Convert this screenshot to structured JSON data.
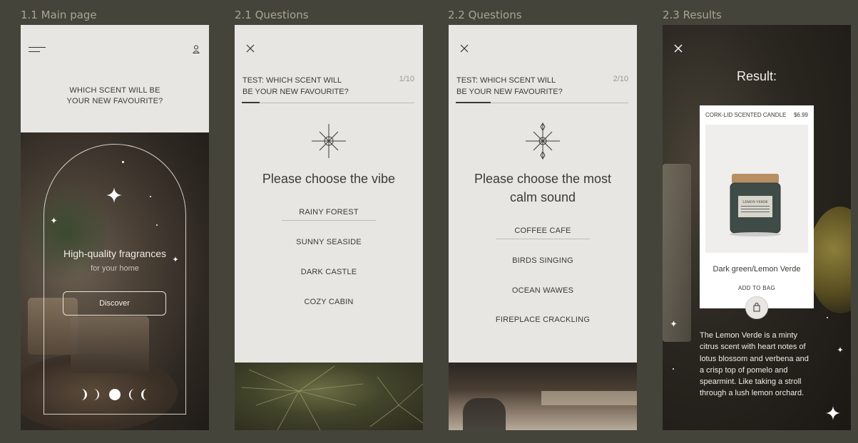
{
  "labels": {
    "main": "1.1 Main page",
    "q1": "2.1 Questions",
    "q2": "2.2 Questions",
    "results": "2.3 Results"
  },
  "main_page": {
    "menu_icon": "hamburger-icon",
    "user_icon": "user-icon",
    "title_line1": "WHICH SCENT WILL BE",
    "title_line2": "YOUR NEW FAVOURITE?",
    "headline": "High-quality fragrances",
    "subline": "for your home",
    "discover_label": "Discover"
  },
  "question1": {
    "test_line1": "TEST: WHICH SCENT WILL",
    "test_line2": "BE YOUR NEW FAVOURITE?",
    "counter": "1/10",
    "progress": 0.1,
    "question_line1": "Please choose the vibe",
    "options": [
      "RAINY FOREST",
      "SUNNY SEASIDE",
      "DARK CASTLE",
      "COZY CABIN"
    ],
    "selected_index": 0
  },
  "question2": {
    "test_line1": "TEST: WHICH SCENT WILL",
    "test_line2": "BE YOUR NEW FAVOURITE?",
    "counter": "2/10",
    "progress": 0.2,
    "question_line1": "Please choose the most",
    "question_line2": "calm sound",
    "options": [
      "COFFEE CAFE",
      "BIRDS SINGING",
      "OCEAN WAWES",
      "FIREPLACE CRACKLING"
    ],
    "selected_index": 0
  },
  "results": {
    "title": "Result:",
    "product_name": "CORK-LID SCENTED CANDLE",
    "price": "$6.99",
    "variant": "Dark green/Lemon Verde",
    "add_to_bag": "ADD TO BAG",
    "jar_label": "LEMON VERDE",
    "description_lines": [
      "The Lemon Verde is a minty",
      "citrus scent with heart notes of",
      "lotus blossom and verbena and",
      "a crisp top of pomelo and",
      "spearmint. Like taking a stroll",
      "through a lush lemon orchard."
    ]
  },
  "colors": {
    "background": "#45443a",
    "screen_light": "#e8e6e2",
    "text_dark": "#3a3a36",
    "label": "#a6a595"
  }
}
